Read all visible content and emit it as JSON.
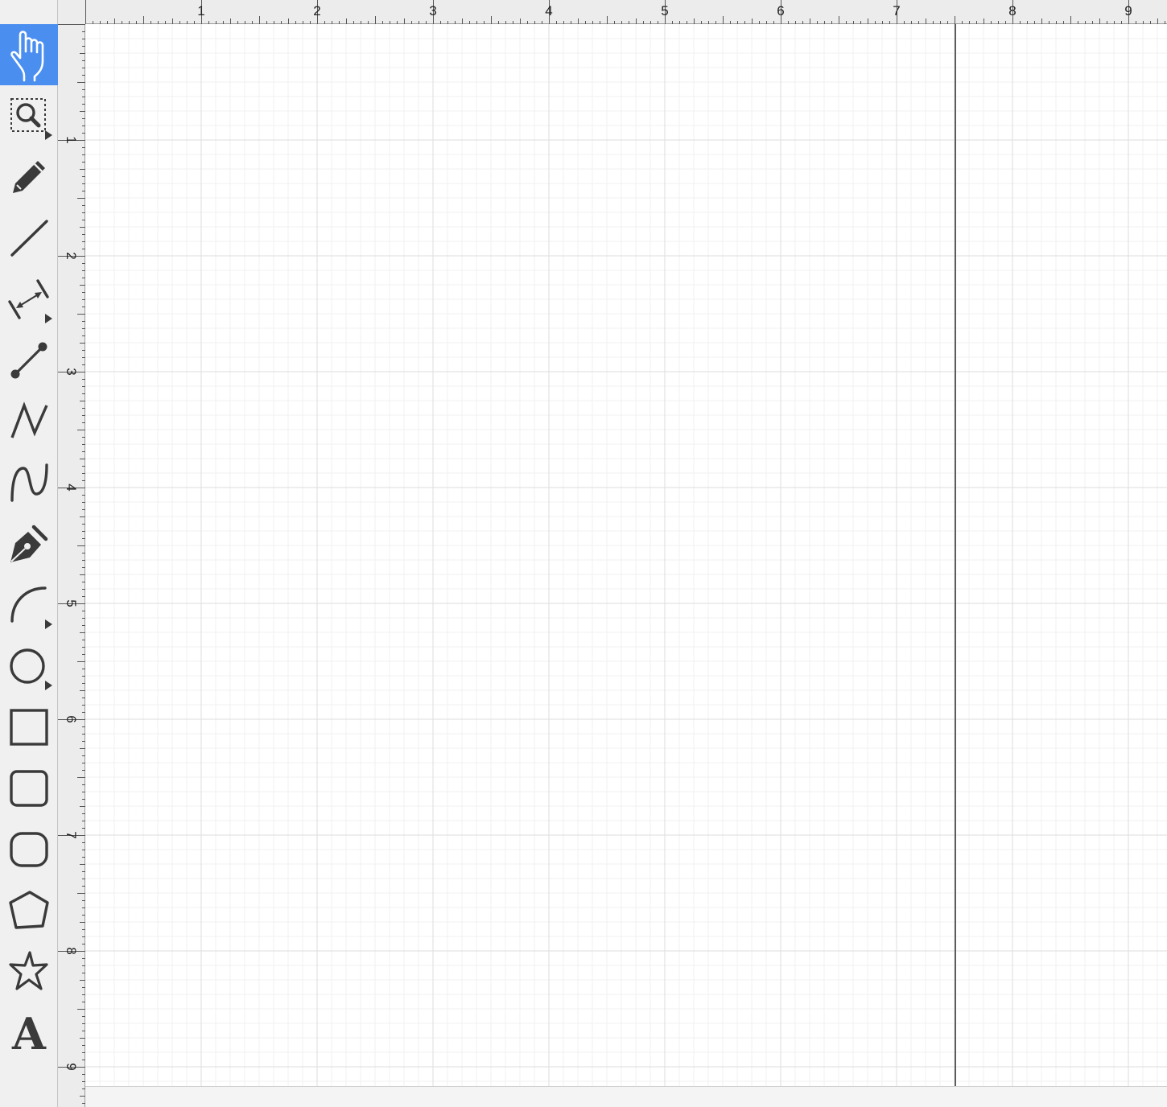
{
  "toolbar": {
    "selected_tool": "hand-tool",
    "tools": [
      {
        "name": "hand-tool",
        "icon": "hand-icon"
      },
      {
        "name": "zoom-tool",
        "icon": "zoom-icon",
        "has_submenu": true
      },
      {
        "name": "pencil-tool",
        "icon": "pencil-icon"
      },
      {
        "name": "line-tool",
        "icon": "line-icon"
      },
      {
        "name": "dimension-tool",
        "icon": "dimension-icon",
        "has_submenu": true
      },
      {
        "name": "connector-tool",
        "icon": "connector-icon"
      },
      {
        "name": "polyline-tool",
        "icon": "polyline-icon"
      },
      {
        "name": "curve-tool",
        "icon": "curve-icon"
      },
      {
        "name": "pen-tool",
        "icon": "pen-icon"
      },
      {
        "name": "arc-tool",
        "icon": "arc-icon",
        "has_submenu": true
      },
      {
        "name": "ellipse-tool",
        "icon": "ellipse-icon",
        "has_submenu": true
      },
      {
        "name": "rectangle-tool",
        "icon": "rectangle-icon"
      },
      {
        "name": "rounded-rectangle-tool",
        "icon": "rounded-rectangle-icon"
      },
      {
        "name": "round-rectangle-tool",
        "icon": "round-rectangle-icon"
      },
      {
        "name": "polygon-tool",
        "icon": "polygon-icon"
      },
      {
        "name": "star-tool",
        "icon": "star-icon"
      },
      {
        "name": "text-tool",
        "icon": "text-icon",
        "glyph": "A"
      }
    ]
  },
  "rulers": {
    "horizontal_labels": [
      "1",
      "2",
      "3",
      "4",
      "5",
      "6",
      "7",
      "8",
      "9"
    ],
    "vertical_labels": [
      "1",
      "2",
      "3",
      "4",
      "5",
      "6",
      "7",
      "8",
      "9"
    ]
  },
  "colors": {
    "selected_tool_bg": "#4a8ef0",
    "icon": "#3a3a3a",
    "grid_major": "#dddddd",
    "grid_minor": "#f1f1f1",
    "page_break": "#5c5c5c"
  }
}
